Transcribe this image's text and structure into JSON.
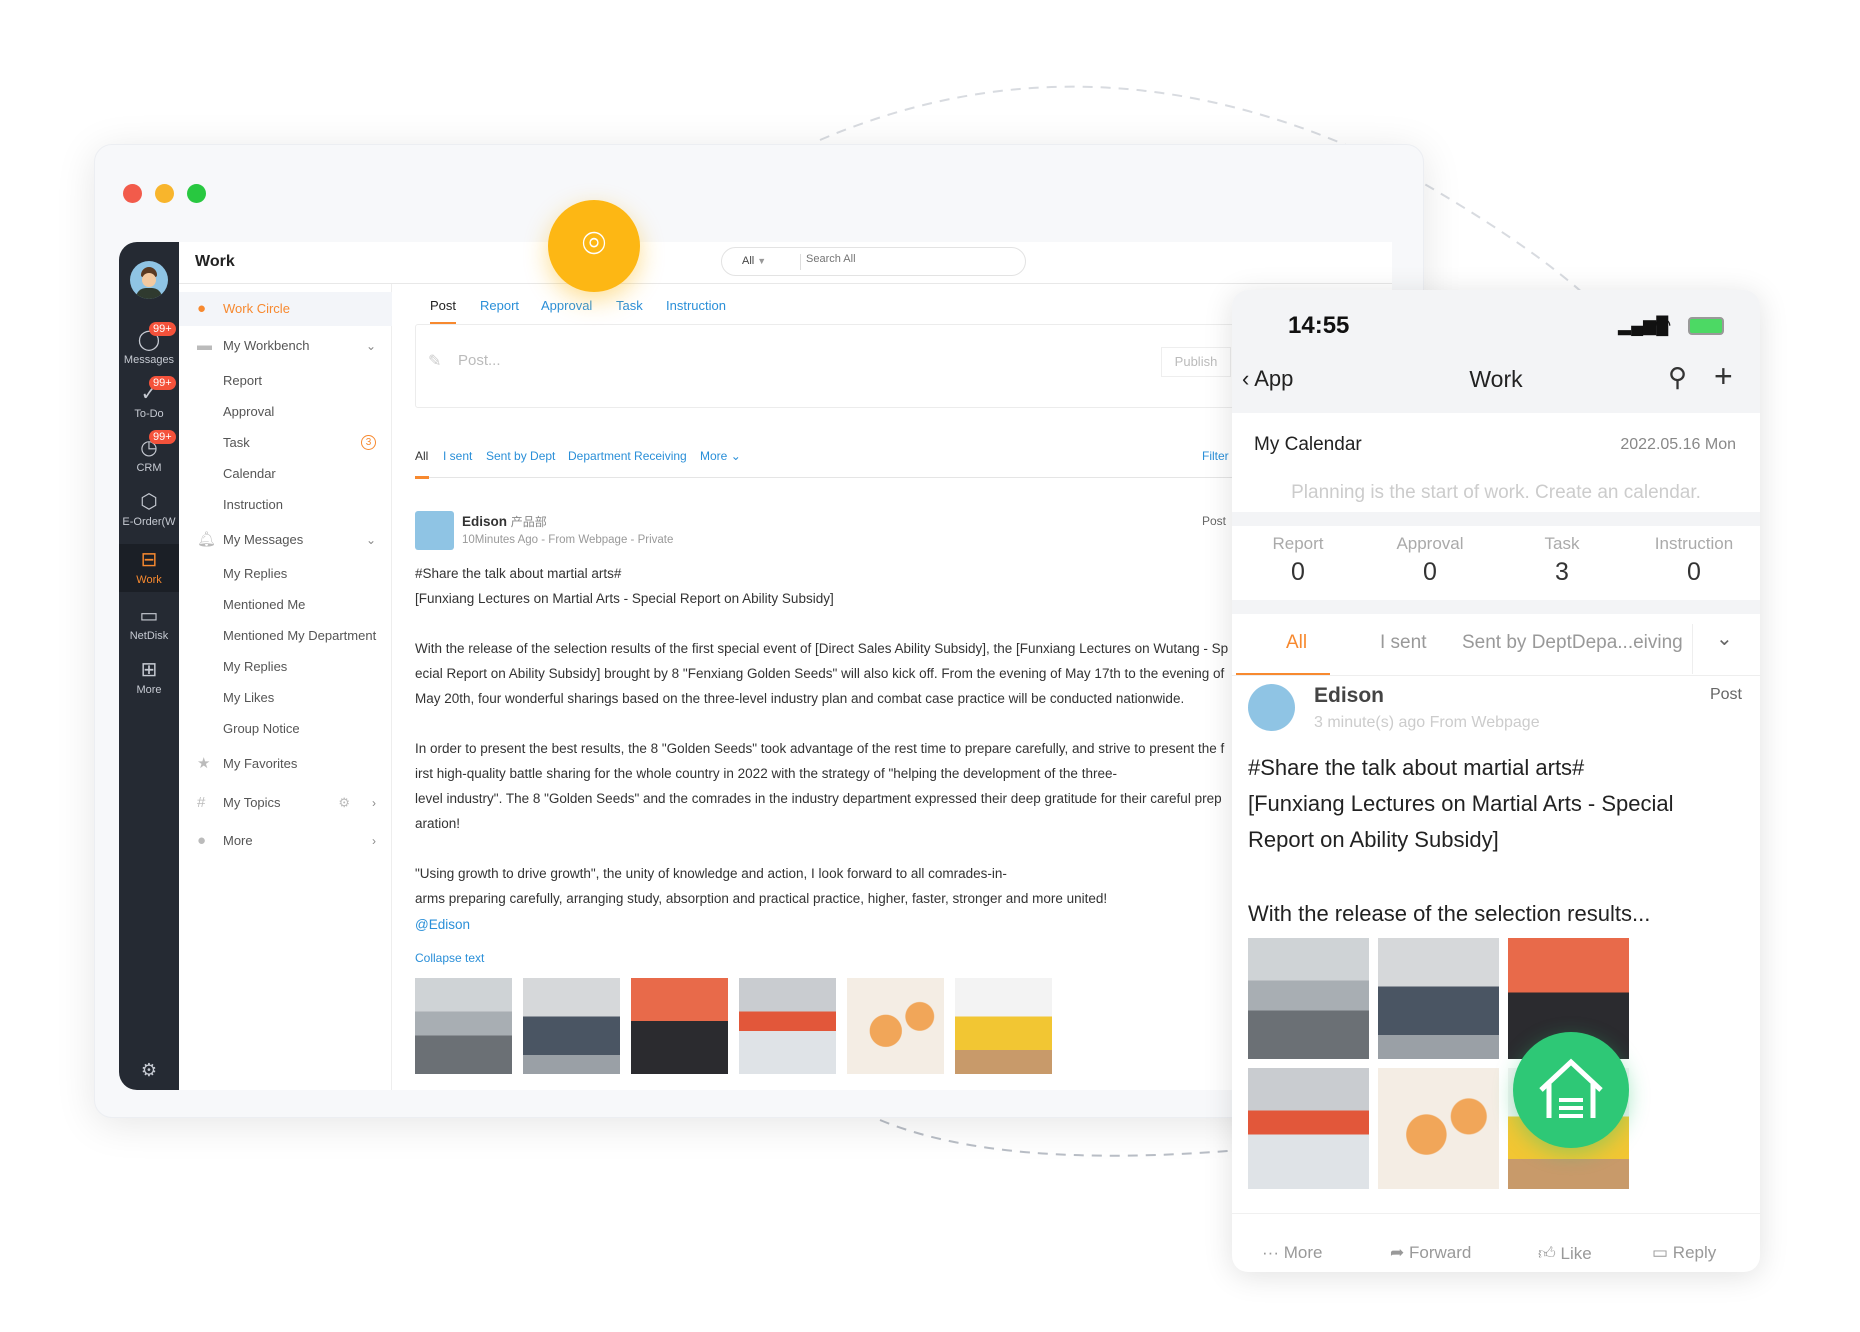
{
  "window": {
    "traffic_colors": [
      "#f25b4b",
      "#f8b52c",
      "#28c840"
    ]
  },
  "rail": {
    "items": [
      {
        "label": "Messages",
        "icon": "chat-bubble-icon",
        "badge": "99+"
      },
      {
        "label": "To-Do",
        "icon": "check-circle-icon",
        "badge": "99+"
      },
      {
        "label": "CRM",
        "icon": "clock-icon",
        "badge": "99+"
      },
      {
        "label": "E-Order(W",
        "icon": "hexagon-order-icon"
      },
      {
        "label": "Work",
        "icon": "briefcase-icon",
        "active": true
      },
      {
        "label": "NetDisk",
        "icon": "disk-icon"
      },
      {
        "label": "More",
        "icon": "grid-icon"
      }
    ]
  },
  "header": {
    "title": "Work",
    "search_scope": "All",
    "search_placeholder": "Search All"
  },
  "sidebar": {
    "work_circle": "Work Circle",
    "workbench": "My Workbench",
    "workbench_items": [
      "Report",
      "Approval",
      "Task",
      "Calendar",
      "Instruction"
    ],
    "task_badge": "3",
    "messages": "My Messages",
    "messages_items": [
      "My Replies",
      "Mentioned Me",
      "Mentioned My Department",
      "My Replies",
      "My Likes",
      "Group Notice"
    ],
    "favorites": "My Favorites",
    "topics": "My Topics",
    "more": "More"
  },
  "main": {
    "tabs": [
      "Post",
      "Report",
      "Approval",
      "Task",
      "Instruction"
    ],
    "post_placeholder": "Post...",
    "publish": "Publish",
    "filters": [
      "All",
      "I sent",
      "Sent by Dept",
      "Department Receiving",
      "More"
    ],
    "filter_button": "Filter",
    "post": {
      "author": "Edison",
      "dept": "产品部",
      "meta": "10Minutes Ago - From Webpage - Private",
      "type": "Post",
      "lines": [
        "#Share the talk about martial arts#",
        "[Funxiang Lectures on Martial Arts - Special Report on Ability Subsidy]",
        "",
        "With the release of the selection results of the first special event of [Direct Sales Ability Subsidy], the [Funxiang Lectures on Wutang - Sp",
        "ecial Report on Ability Subsidy] brought by 8 \"Fenxiang Golden Seeds\" will also kick off. From the evening of May 17th to the evening of",
        "May 20th, four wonderful sharings based on the three-level industry plan and combat case practice will be conducted nationwide.",
        "",
        "In order to present the best results, the 8 \"Golden Seeds\" took advantage of the rest time to prepare carefully, and strive to present the f",
        "irst high-quality battle sharing for the whole country in 2022 with the strategy of \"helping the development of the three-",
        "level industry\". The 8 \"Golden Seeds\" and the comrades in the industry department expressed their deep gratitude for their careful prep",
        "aration!",
        "",
        "\"Using growth to drive growth\", the unity of knowledge and action, I look forward to all comrades-in-",
        "arms preparing carefully, arranging study, absorption and practical practice, higher, faster, stronger and more united!"
      ],
      "mention": "@Edison",
      "collapse": "Collapse text"
    }
  },
  "phone": {
    "time": "14:55",
    "back": "App",
    "title": "Work",
    "calendar_title": "My Calendar",
    "calendar_date": "2022.05.16 Mon",
    "calendar_hint": "Planning is the start of work. Create an calendar.",
    "stats": [
      {
        "label": "Report",
        "value": "0"
      },
      {
        "label": "Approval",
        "value": "0"
      },
      {
        "label": "Task",
        "value": "3"
      },
      {
        "label": "Instruction",
        "value": "0"
      }
    ],
    "tabs": [
      "All",
      "I sent",
      "Sent by DeptDepa...eiving"
    ],
    "post": {
      "author": "Edison",
      "meta": "3 minute(s) ago From Webpage",
      "type": "Post",
      "lines": [
        "#Share the talk about martial arts#",
        "[Funxiang Lectures on Martial Arts - Special",
        "Report on Ability Subsidy]"
      ],
      "summary": "With the release of the selection results..."
    },
    "actions": [
      "More",
      "Forward",
      "Like",
      "Reply"
    ]
  },
  "colors": {
    "accent": "#f7892f",
    "link": "#2a8fd8",
    "rail": "#252a33",
    "pin": "#fdb714",
    "home": "#2ec876"
  }
}
